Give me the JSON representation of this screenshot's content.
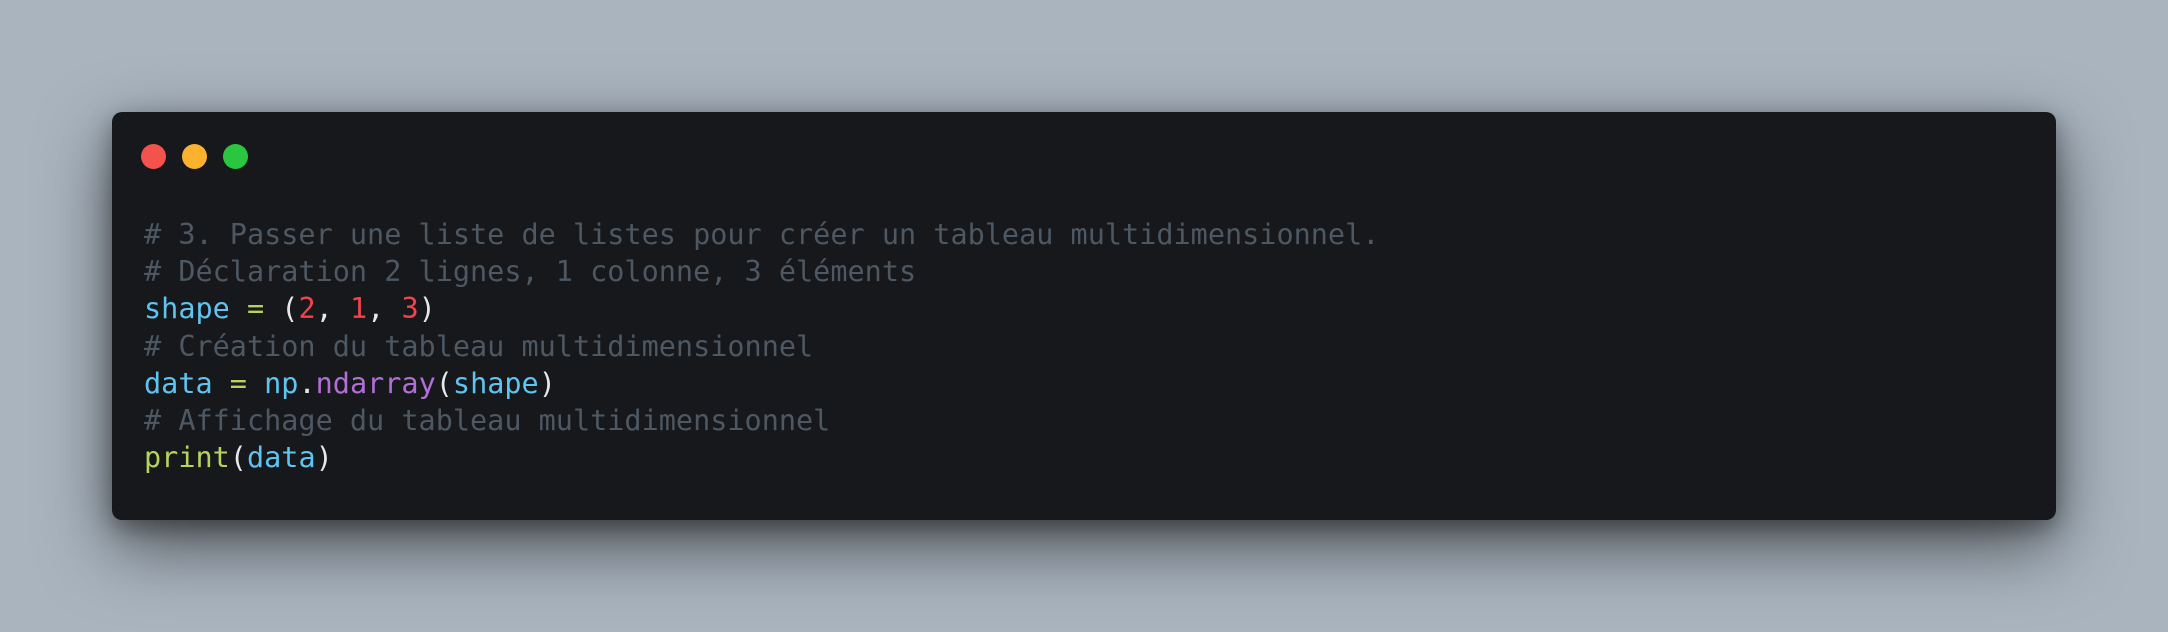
{
  "window_controls": {
    "close_color": "#f4534d",
    "minimize_color": "#fdb22f",
    "maximize_color": "#2ac63f",
    "close_icon": "close-dot-icon",
    "minimize_icon": "minimize-dot-icon",
    "maximize_icon": "maximize-dot-icon"
  },
  "code": {
    "language": "python",
    "lines": [
      {
        "comment": "# 3. Passer une liste de listes pour créer un tableau multidimensionnel."
      },
      {
        "comment": "# Déclaration 2 lignes, 1 colonne, 3 éléments"
      },
      {
        "var": "shape",
        "op": " = ",
        "open": "(",
        "n1": "2",
        "sep1": ", ",
        "n2": "1",
        "sep2": ", ",
        "n3": "3",
        "close": ")"
      },
      {
        "comment": "# Création du tableau multidimensionnel"
      },
      {
        "var": "data",
        "op": " = ",
        "module": "np",
        "dot": ".",
        "func": "ndarray",
        "open": "(",
        "arg": "shape",
        "close": ")"
      },
      {
        "comment": "# Affichage du tableau multidimensionnel"
      },
      {
        "func": "print",
        "open": "(",
        "arg": "data",
        "close": ")"
      }
    ]
  },
  "colors": {
    "background": "#a9b4bf",
    "window": "#16181b",
    "comment": "#4d5863",
    "variable": "#5fc4f0",
    "operator": "#b6d35e",
    "number": "#f1434c",
    "function": "#b26fd3"
  }
}
